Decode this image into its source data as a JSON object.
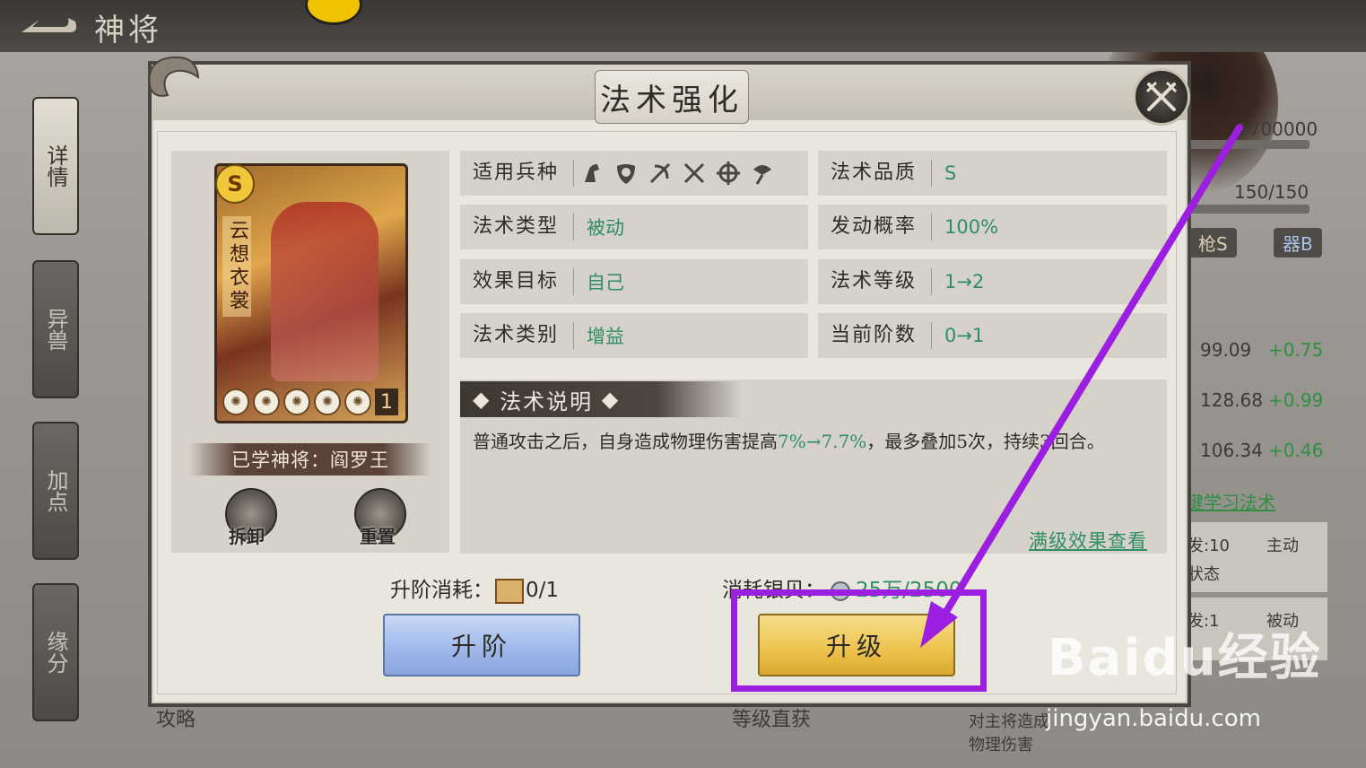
{
  "header": {
    "back_icon": "back-arrow-icon",
    "title": "神将"
  },
  "side_tabs": [
    {
      "label": "详情",
      "active": true
    },
    {
      "label": "异兽",
      "active": false
    },
    {
      "label": "加点",
      "active": false
    },
    {
      "label": "缘分",
      "active": false
    }
  ],
  "right_panel": {
    "exp": "1700000",
    "stamina": "150/150",
    "badge1": "枪S",
    "badge2": "器B",
    "stats": [
      {
        "value": "99.09",
        "delta": "+0.75"
      },
      {
        "value": "128.68",
        "delta": "+0.99"
      },
      {
        "value": "106.34",
        "delta": "+0.46"
      }
    ],
    "learn_link": "键学习法术",
    "skills": [
      {
        "a": "发:10",
        "b": "主动",
        "c": "状态"
      },
      {
        "a": "发:1",
        "b": "被动",
        "c": ""
      }
    ]
  },
  "modal": {
    "title": "法术强化",
    "close_icon": "crossed-swords-close-icon",
    "card": {
      "grade": "S",
      "name": "云想衣裳",
      "stars": 5,
      "level": "1"
    },
    "learned_by": "已学神将：阎罗王",
    "uninstall_label": "拆卸",
    "reset_label": "重置",
    "attributes_left": [
      {
        "key": "适用兵种",
        "value": ""
      },
      {
        "key": "法术类型",
        "value": "被动"
      },
      {
        "key": "效果目标",
        "value": "自己"
      },
      {
        "key": "法术类别",
        "value": "增益"
      }
    ],
    "attributes_right": [
      {
        "key": "法术品质",
        "value": "S"
      },
      {
        "key": "发动概率",
        "value": "100%"
      },
      {
        "key": "法术等级",
        "value": "1→2"
      },
      {
        "key": "当前阶数",
        "value": "0→1"
      }
    ],
    "troop_icons": [
      "cavalry-icon",
      "shield-icon",
      "bow-icon",
      "crossed-blades-icon",
      "target-icon",
      "fan-icon"
    ],
    "description_title": "法术说明",
    "description_pre": "普通攻击之后，自身造成物理伤害提高",
    "description_highlight": "7%→7.7%",
    "description_post": "，最多叠加5次，持续3回合。",
    "max_level_link": "满级效果查看",
    "advance_cost_label": "升阶消耗：",
    "advance_cost_value": "0/1",
    "silver_cost_label": "消耗银贝：",
    "silver_cost_value": "25万/2500",
    "advance_button": "升阶",
    "upgrade_button": "升级"
  },
  "watermark": {
    "logo": "Baidu经验",
    "url": "jingyan.baidu.com"
  },
  "bottom_bg_text": {
    "left": "攻略",
    "mid": "等级直获",
    "right": "对主将造成物理伤害"
  },
  "colors": {
    "highlight": "#9c1ee0",
    "green": "#2e8f62",
    "gold": "#ecc24c",
    "blue": "#9eb7ea"
  }
}
